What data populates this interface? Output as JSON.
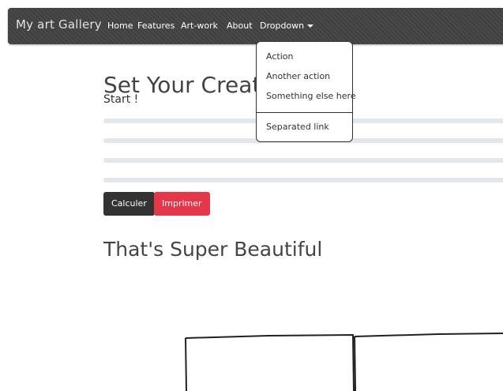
{
  "navbar": {
    "brand": "My art Gallery",
    "items": [
      {
        "label": "Home"
      },
      {
        "label": "Features"
      },
      {
        "label": "Art-work"
      },
      {
        "label": "About"
      },
      {
        "label": "Dropdown"
      }
    ]
  },
  "dropdown": {
    "items": [
      {
        "label": "Action"
      },
      {
        "label": "Another action"
      },
      {
        "label": "Something else here"
      },
      {
        "label": "Separated link"
      }
    ]
  },
  "hero": {
    "title": "Set Your Creations",
    "start": "Start !"
  },
  "progress_bars": [
    0,
    0,
    0,
    0
  ],
  "buttons": {
    "calculer": "Calculer",
    "imprimer": "Imprimer"
  },
  "subtitle": "That's Super Beautiful",
  "colors": {
    "navbar": "#444444",
    "danger": "#e5364a",
    "dark": "#333333"
  }
}
